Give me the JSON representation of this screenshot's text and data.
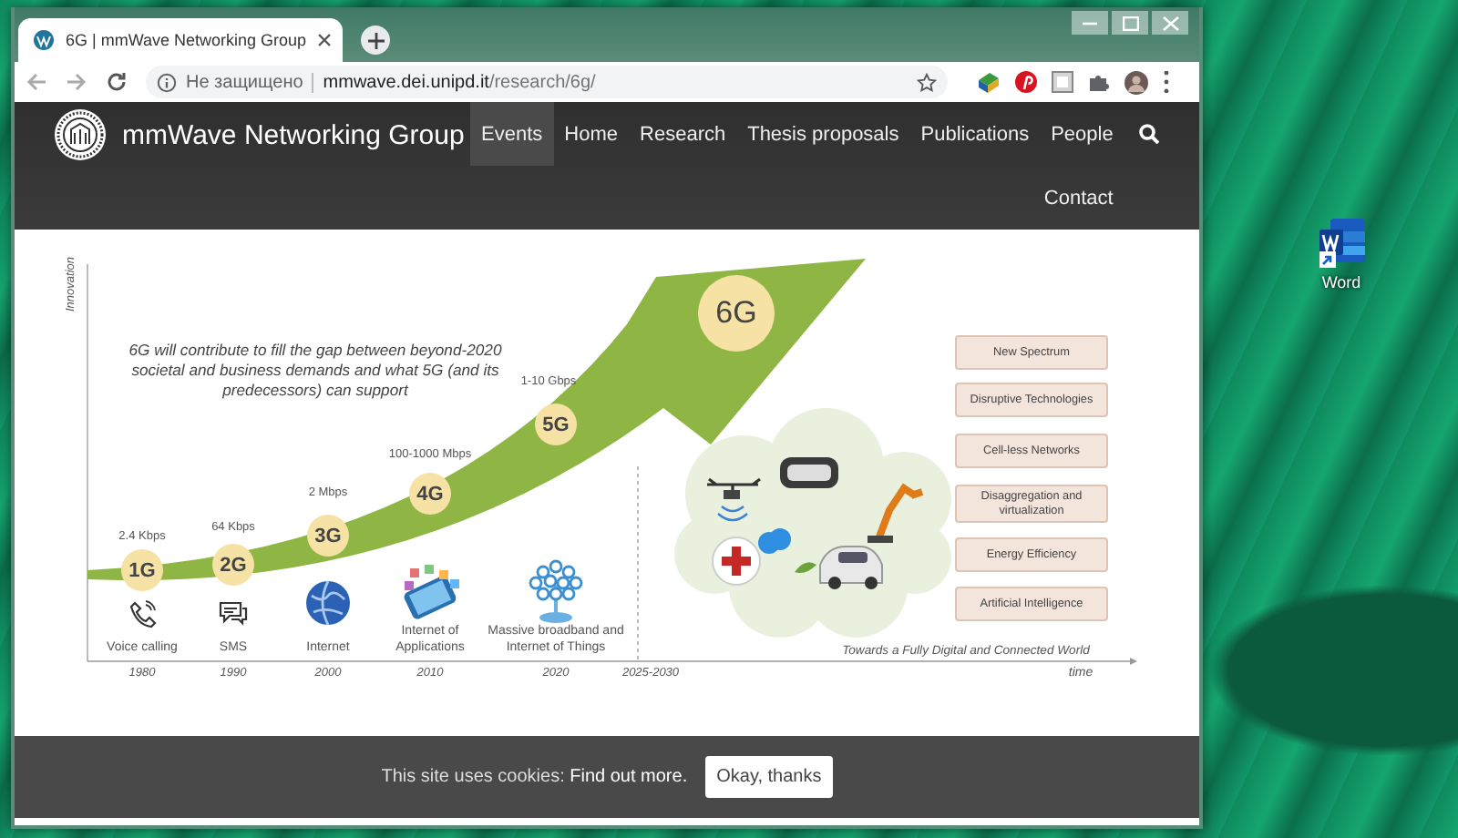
{
  "desktop": {
    "icon_label": "Word"
  },
  "browser": {
    "tab_title": "6G | mmWave Networking Group",
    "security_label": "Не защищено",
    "url_host": "mmwave.dei.unipd.it",
    "url_path": "/research/6g/"
  },
  "site": {
    "title": "mmWave Networking Group",
    "nav": [
      {
        "label": "Events",
        "selected": true
      },
      {
        "label": "Home",
        "selected": false
      },
      {
        "label": "Research",
        "selected": false
      },
      {
        "label": "Thesis proposals",
        "selected": false
      },
      {
        "label": "Publications",
        "selected": false
      },
      {
        "label": "People",
        "selected": false
      },
      {
        "label": "Contact",
        "selected": false
      }
    ]
  },
  "figure": {
    "y_axis_label": "Innovation",
    "x_axis_label": "time",
    "caption": "6G will contribute to fill the gap between beyond-2020 societal and business demands and what 5G (and its predecessors) can support",
    "generations": [
      {
        "badge": "1G",
        "speed": "2.4 Kbps",
        "application": "Voice calling",
        "year": "1980"
      },
      {
        "badge": "2G",
        "speed": "64 Kbps",
        "application": "SMS",
        "year": "1990"
      },
      {
        "badge": "3G",
        "speed": "2 Mbps",
        "application": "Internet",
        "year": "2000"
      },
      {
        "badge": "4G",
        "speed": "100-1000 Mbps",
        "application": "Internet of Applications",
        "year": "2010"
      },
      {
        "badge": "5G",
        "speed": "1-10 Gbps",
        "application": "Massive broadband and Internet of Things",
        "year": "2020"
      }
    ],
    "future": {
      "badge": "6G",
      "period": "2025-2030",
      "world_caption": "Towards a Fully Digital and Connected World",
      "features": [
        "New Spectrum",
        "Disruptive Technologies",
        "Cell-less Networks",
        "Disaggregation and virtualization",
        "Energy Efficiency",
        "Artificial Intelligence"
      ]
    }
  },
  "cookie_bar": {
    "message": "This site uses cookies:",
    "link": "Find out more.",
    "button": "Okay, thanks"
  }
}
